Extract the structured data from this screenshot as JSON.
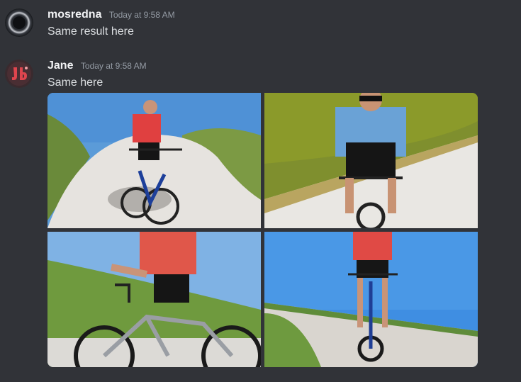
{
  "messages": [
    {
      "username": "mosredna",
      "timestamp": "Today at 9:58 AM",
      "text": "Same result here",
      "avatar_icon": "dark-orb-avatar",
      "username_color": "#f2f3f5"
    },
    {
      "username": "Jane",
      "timestamp": "Today at 9:58 AM",
      "text": "Same here",
      "avatar_icon": "red-figure-avatar",
      "username_color": "#f2f3f5"
    }
  ],
  "attachments": [
    {
      "subject": "cyclist in red shirt riding up curved white road between grassy hills"
    },
    {
      "subject": "cyclist in blue jersey with sunglasses on white road"
    },
    {
      "subject": "cyclist in red shirt on mountain bike beside grassy slope"
    },
    {
      "subject": "cyclist in red shirt riding toward camera on road"
    }
  ],
  "colors": {
    "background": "#313338",
    "text": "#dbdee1",
    "muted": "#949ba4"
  }
}
